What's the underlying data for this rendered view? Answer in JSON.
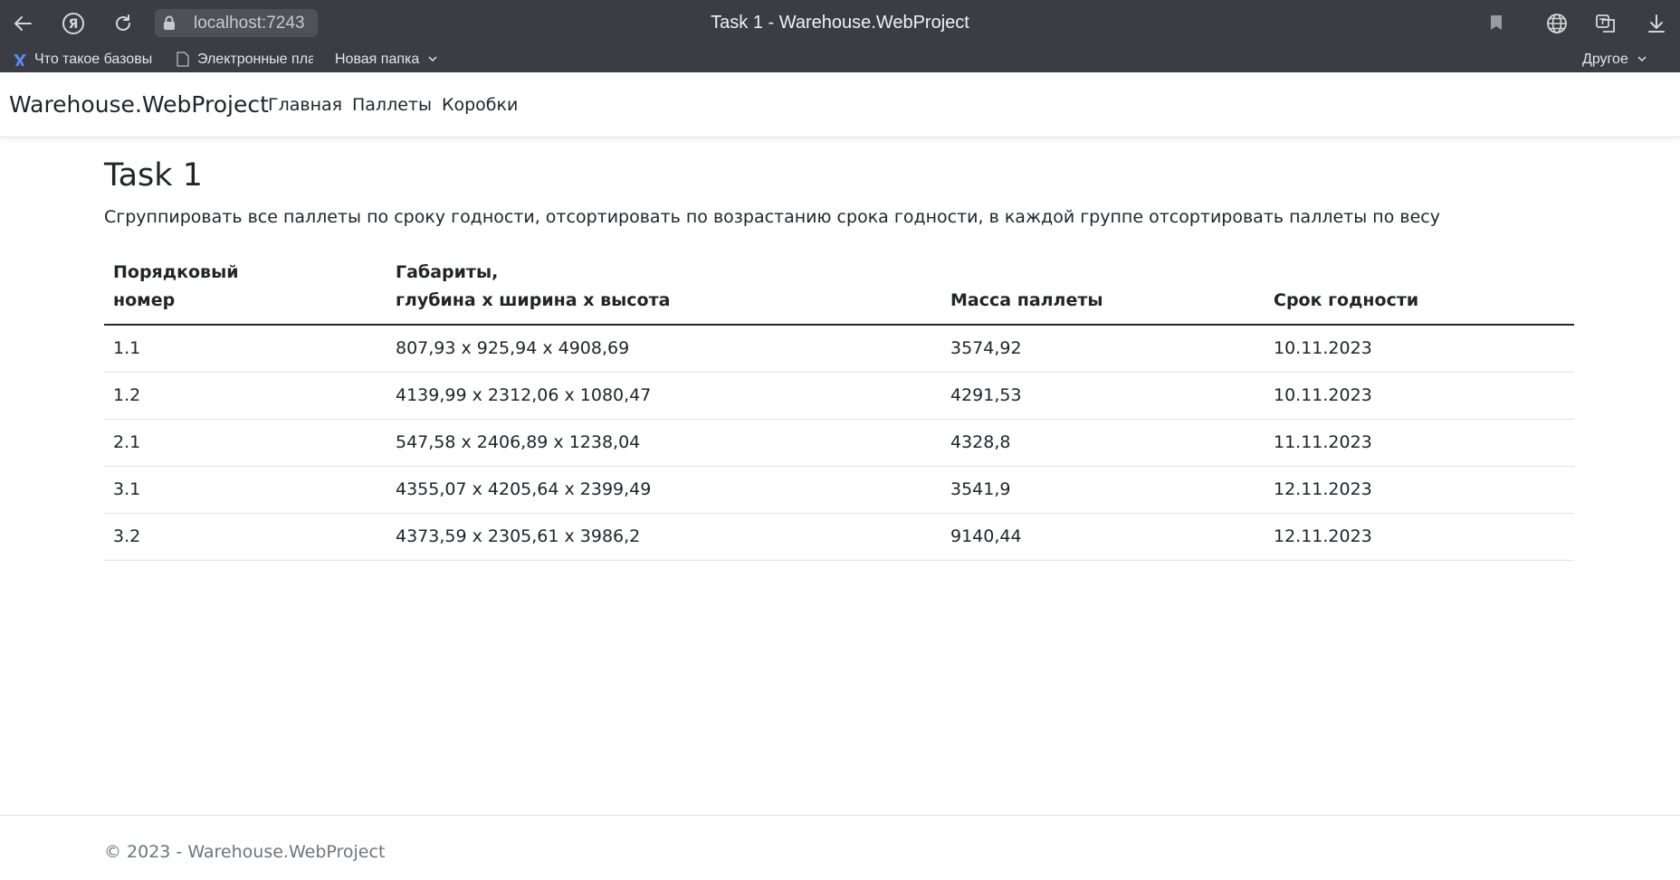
{
  "browser": {
    "url": "localhost:7243",
    "tab_title": "Task 1 - Warehouse.WebProject",
    "bookmarks": [
      {
        "label": "Что такое базовы",
        "icon": "puzzle-icon"
      },
      {
        "label": "Электронные пла",
        "icon": "page-icon"
      },
      {
        "label": "Новая папка",
        "icon": "folder-icon",
        "dropdown": true
      }
    ],
    "other_bookmarks": "Другое"
  },
  "navbar": {
    "brand": "Warehouse.WebProject",
    "links": [
      "Главная",
      "Паллеты",
      "Коробки"
    ]
  },
  "main": {
    "title": "Task 1",
    "description": "Сгруппировать все паллеты по сроку годности, отсортировать по возрастанию срока годности, в каждой группе отсортировать паллеты по весу",
    "table": {
      "headers": [
        {
          "line1": "Порядковый",
          "line2": "номер"
        },
        {
          "line1": "Габариты,",
          "line2": "глубина х ширина х высота"
        },
        {
          "line1": "",
          "line2": "Масса паллеты"
        },
        {
          "line1": "",
          "line2": "Срок годности"
        }
      ],
      "rows": [
        [
          "1.1",
          "807,93 x 925,94 x 4908,69",
          "3574,92",
          "10.11.2023"
        ],
        [
          "1.2",
          "4139,99 x 2312,06 x 1080,47",
          "4291,53",
          "10.11.2023"
        ],
        [
          "2.1",
          "547,58 x 2406,89 x 1238,04",
          "4328,8",
          "11.11.2023"
        ],
        [
          "3.1",
          "4355,07 x 4205,64 x 2399,49",
          "3541,9",
          "12.11.2023"
        ],
        [
          "3.2",
          "4373,59 x 2305,61 x 3986,2",
          "9140,44",
          "12.11.2023"
        ]
      ]
    }
  },
  "footer": {
    "text": "© 2023 - Warehouse.WebProject"
  }
}
